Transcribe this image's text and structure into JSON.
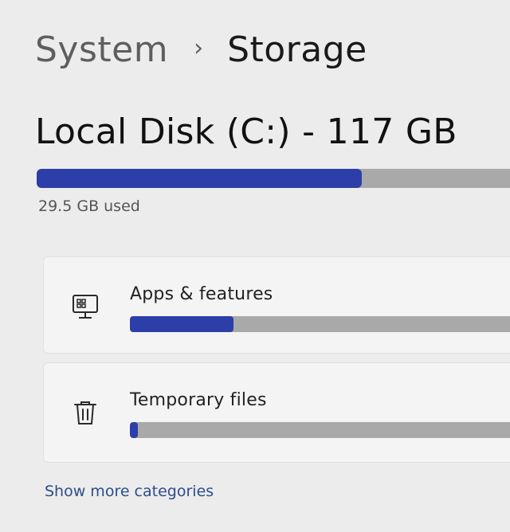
{
  "breadcrumb": {
    "parent": "System",
    "separator": "›",
    "current": "Storage"
  },
  "disk": {
    "title": "Local Disk (C:) - 117 GB",
    "used_label": "29.5 GB used",
    "used_fraction": 0.68
  },
  "categories": [
    {
      "label": "Apps & features",
      "icon": "apps-features-icon",
      "usage_fraction": 0.26
    },
    {
      "label": "Temporary files",
      "icon": "trash-icon",
      "usage_fraction": 0.02
    }
  ],
  "show_more_label": "Show more categories",
  "colors": {
    "accent": "#2d3ea8",
    "track": "#a9a9a9",
    "link": "#2b4d8c"
  }
}
